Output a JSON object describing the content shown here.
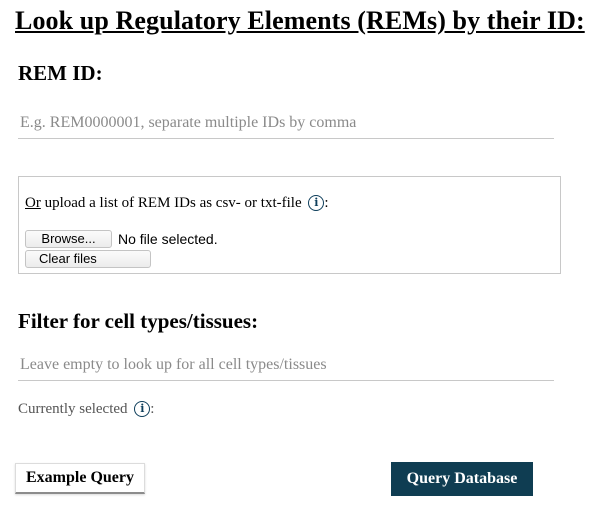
{
  "page": {
    "title": "Look up Regulatory Elements (REMs) by their ID:"
  },
  "rem_id": {
    "label": "REM ID:",
    "placeholder": "E.g. REM0000001, separate multiple IDs by comma",
    "value": ""
  },
  "upload": {
    "or_text": "Or",
    "text": " upload a list of REM IDs as csv- or txt-file",
    "info_icon_glyph": "i",
    "colon": ":",
    "browse_label": "Browse...",
    "file_status": "No file selected.",
    "clear_label": "Clear files"
  },
  "filter": {
    "label": "Filter for cell types/tissues:",
    "placeholder": "Leave empty to look up for all cell types/tissues",
    "value": "",
    "currently_selected_label": "Currently selected",
    "info_icon_glyph": "i",
    "colon": ":"
  },
  "actions": {
    "example_label": "Example Query",
    "query_label": "Query Database"
  },
  "colors": {
    "accent": "#0f3d52",
    "info_icon": "#0f3f5c"
  }
}
